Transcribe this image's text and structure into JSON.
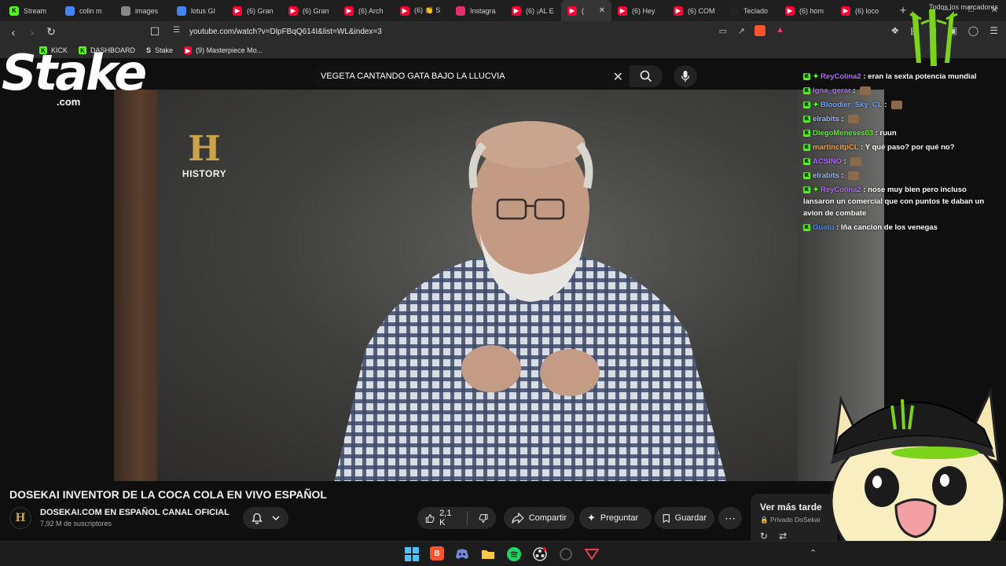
{
  "browser": {
    "tabs": [
      {
        "label": "Stream",
        "icon": "kick-icon",
        "color": "#53fc18"
      },
      {
        "label": "colin m",
        "icon": "google-icon",
        "color": "#4285f4"
      },
      {
        "label": "images",
        "icon": "globe-icon",
        "color": "#888888"
      },
      {
        "label": "lotus GI",
        "icon": "google-icon",
        "color": "#4285f4"
      },
      {
        "label": "(6) Gran",
        "icon": "youtube-icon",
        "color": "#ff0033"
      },
      {
        "label": "(6) Gran",
        "icon": "youtube-icon",
        "color": "#ff0033"
      },
      {
        "label": "(6) Arch",
        "icon": "youtube-icon",
        "color": "#ff0033"
      },
      {
        "label": "(6) 👏 S",
        "icon": "youtube-icon",
        "color": "#ff0033"
      },
      {
        "label": "Instagra",
        "icon": "instagram-icon",
        "color": "#e1306c"
      },
      {
        "label": "(6) ¡AL E",
        "icon": "youtube-icon",
        "color": "#ff0033"
      },
      {
        "label": "(",
        "icon": "youtube-icon",
        "color": "#ff0033",
        "active": true
      },
      {
        "label": "(6) Hey",
        "icon": "youtube-icon",
        "color": "#ff0033"
      },
      {
        "label": "(6) COM",
        "icon": "youtube-icon",
        "color": "#ff0033"
      },
      {
        "label": "Teclado",
        "icon": "brand-icon",
        "color": "#222222"
      },
      {
        "label": "(6) hom",
        "icon": "youtube-icon",
        "color": "#ff0033"
      },
      {
        "label": "(6) loco",
        "icon": "youtube-icon",
        "color": "#ff0033"
      }
    ],
    "url": "youtube.com/watch?v=DlpFBqQ614I&list=WL&index=3",
    "bookmarks": [
      {
        "label": "KICK",
        "icon": "kick-icon"
      },
      {
        "label": "DASHBOARD",
        "icon": "kick-icon"
      },
      {
        "label": "Stake",
        "icon": "stake-icon"
      },
      {
        "label": "(9) Masterpiece Mo...",
        "icon": "youtube-icon"
      }
    ],
    "bookmarks_right": "Todos los marcadores",
    "brave_badge": "6"
  },
  "youtube": {
    "search_query": "VEGETA CANTANDO GATA BAJO LA LLUCVIA",
    "video_overlay_logo": "HISTORY",
    "title": "DOSEKAI INVENTOR DE LA COCA COLA EN VIVO ESPAÑOL",
    "channel": {
      "name": "DOSEKAI.COM EN ESPAÑOL CANAL OFICIAL",
      "subscribers": "7,92 M de suscriptores"
    },
    "actions": {
      "likes": "2,1 K",
      "share": "Compartir",
      "ask": "Preguntar",
      "save": "Guardar"
    },
    "playlist": {
      "title": "Ver más tarde",
      "subtitle": "Privado DoSekai"
    }
  },
  "overlay": {
    "stake_word": "Stake",
    "stake_domain": ".com",
    "chat": [
      {
        "user": "ReyColina2",
        "color": "#b36bff",
        "star": true,
        "text": "eran la sexta potencia mundial"
      },
      {
        "user": "Igna_gerar",
        "color": "#b36bff",
        "star": false,
        "text": ""
      },
      {
        "user": "Bloodier_Sky_CL",
        "color": "#6fa8ff",
        "star": true,
        "text": ""
      },
      {
        "user": "elrabits",
        "color": "#9ab8ff",
        "star": false,
        "text": ""
      },
      {
        "user": "DiegoMeneses03",
        "color": "#53fc18",
        "star": false,
        "text": "ruun"
      },
      {
        "user": "martincitpCL",
        "color": "#ff9f3a",
        "star": false,
        "text": "Y qué paso? por qué no?"
      },
      {
        "user": "ACSINO",
        "color": "#b36bff",
        "star": false,
        "text": ""
      },
      {
        "user": "elrabits",
        "color": "#9ab8ff",
        "star": false,
        "text": ""
      },
      {
        "user": "ReyColina2",
        "color": "#b36bff",
        "star": true,
        "text": "nose muy bien pero incluso lansaron un comercial que con puntos te daban un avion de combate"
      },
      {
        "user": "Guatu",
        "color": "#4a8cff",
        "star": false,
        "text": "lña cancion de los venegas"
      }
    ]
  }
}
